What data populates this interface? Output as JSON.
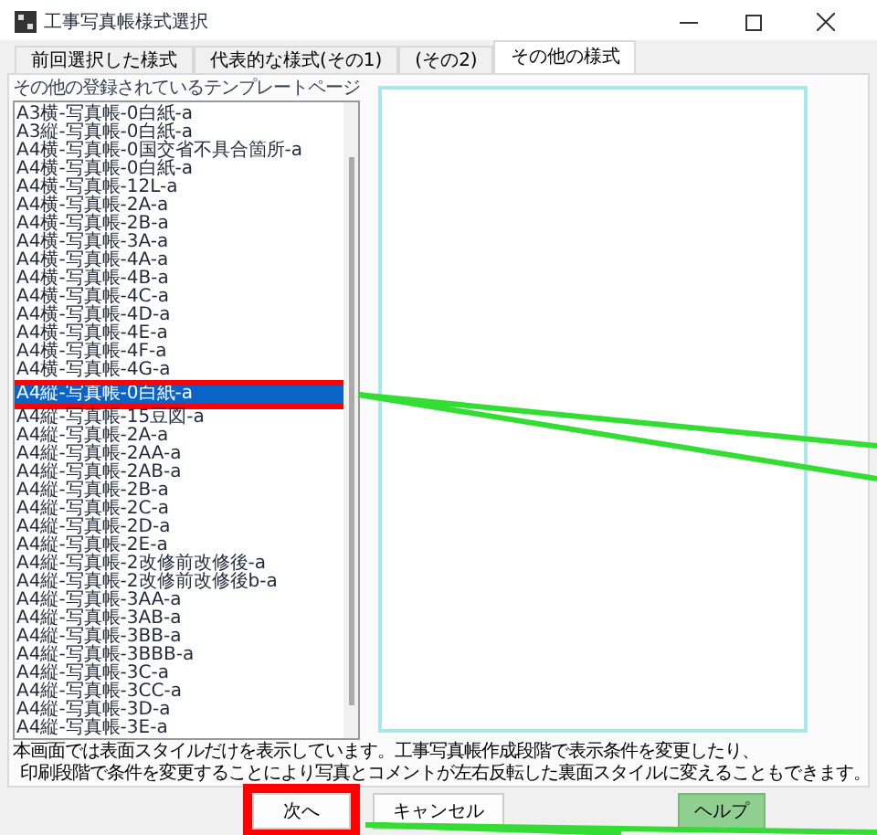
{
  "window": {
    "title": "工事写真帳様式選択"
  },
  "tabs": [
    {
      "label": "前回選択した様式",
      "selected": false
    },
    {
      "label": "代表的な様式(その1)",
      "selected": false
    },
    {
      "label": "(その2)",
      "selected": false
    },
    {
      "label": "その他の様式",
      "selected": true
    }
  ],
  "template_list": {
    "heading": "その他の登録されているテンプレートページ",
    "items": [
      {
        "label": "A3横-写真帳-0白紙-a",
        "selected": false
      },
      {
        "label": "A3縦-写真帳-0白紙-a",
        "selected": false
      },
      {
        "label": "A4横-写真帳-0国交省不具合箇所-a",
        "selected": false
      },
      {
        "label": "A4横-写真帳-0白紙-a",
        "selected": false
      },
      {
        "label": "A4横-写真帳-12L-a",
        "selected": false
      },
      {
        "label": "A4横-写真帳-2A-a",
        "selected": false
      },
      {
        "label": "A4横-写真帳-2B-a",
        "selected": false
      },
      {
        "label": "A4横-写真帳-3A-a",
        "selected": false
      },
      {
        "label": "A4横-写真帳-4A-a",
        "selected": false
      },
      {
        "label": "A4横-写真帳-4B-a",
        "selected": false
      },
      {
        "label": "A4横-写真帳-4C-a",
        "selected": false
      },
      {
        "label": "A4横-写真帳-4D-a",
        "selected": false
      },
      {
        "label": "A4横-写真帳-4E-a",
        "selected": false
      },
      {
        "label": "A4横-写真帳-4F-a",
        "selected": false
      },
      {
        "label": "A4横-写真帳-4G-a",
        "selected": false
      },
      {
        "label": "A4縦-写真帳-0白紙-a",
        "selected": true
      },
      {
        "label": "A4縦-写真帳-15豆図-a",
        "selected": false
      },
      {
        "label": "A4縦-写真帳-2A-a",
        "selected": false
      },
      {
        "label": "A4縦-写真帳-2AA-a",
        "selected": false
      },
      {
        "label": "A4縦-写真帳-2AB-a",
        "selected": false
      },
      {
        "label": "A4縦-写真帳-2B-a",
        "selected": false
      },
      {
        "label": "A4縦-写真帳-2C-a",
        "selected": false
      },
      {
        "label": "A4縦-写真帳-2D-a",
        "selected": false
      },
      {
        "label": "A4縦-写真帳-2E-a",
        "selected": false
      },
      {
        "label": "A4縦-写真帳-2改修前改修後-a",
        "selected": false
      },
      {
        "label": "A4縦-写真帳-2改修前改修後b-a",
        "selected": false
      },
      {
        "label": "A4縦-写真帳-3AA-a",
        "selected": false
      },
      {
        "label": "A4縦-写真帳-3AB-a",
        "selected": false
      },
      {
        "label": "A4縦-写真帳-3BB-a",
        "selected": false
      },
      {
        "label": "A4縦-写真帳-3BBB-a",
        "selected": false
      },
      {
        "label": "A4縦-写真帳-3C-a",
        "selected": false
      },
      {
        "label": "A4縦-写真帳-3CC-a",
        "selected": false
      },
      {
        "label": "A4縦-写真帳-3D-a",
        "selected": false
      },
      {
        "label": "A4縦-写真帳-3E-a",
        "selected": false
      }
    ]
  },
  "notes": [
    "本画面では表面スタイルだけを表示しています。工事写真帳作成段階で表示条件を変更したり、",
    "印刷段階で条件を変更することにより写真とコメントが左右反転した裏面スタイルに変えることもできます。"
  ],
  "buttons": [
    {
      "label": "次へ",
      "kind": "default"
    },
    {
      "label": "キャンセル",
      "kind": "default"
    },
    {
      "label": "ヘルプ",
      "kind": "help"
    }
  ]
}
